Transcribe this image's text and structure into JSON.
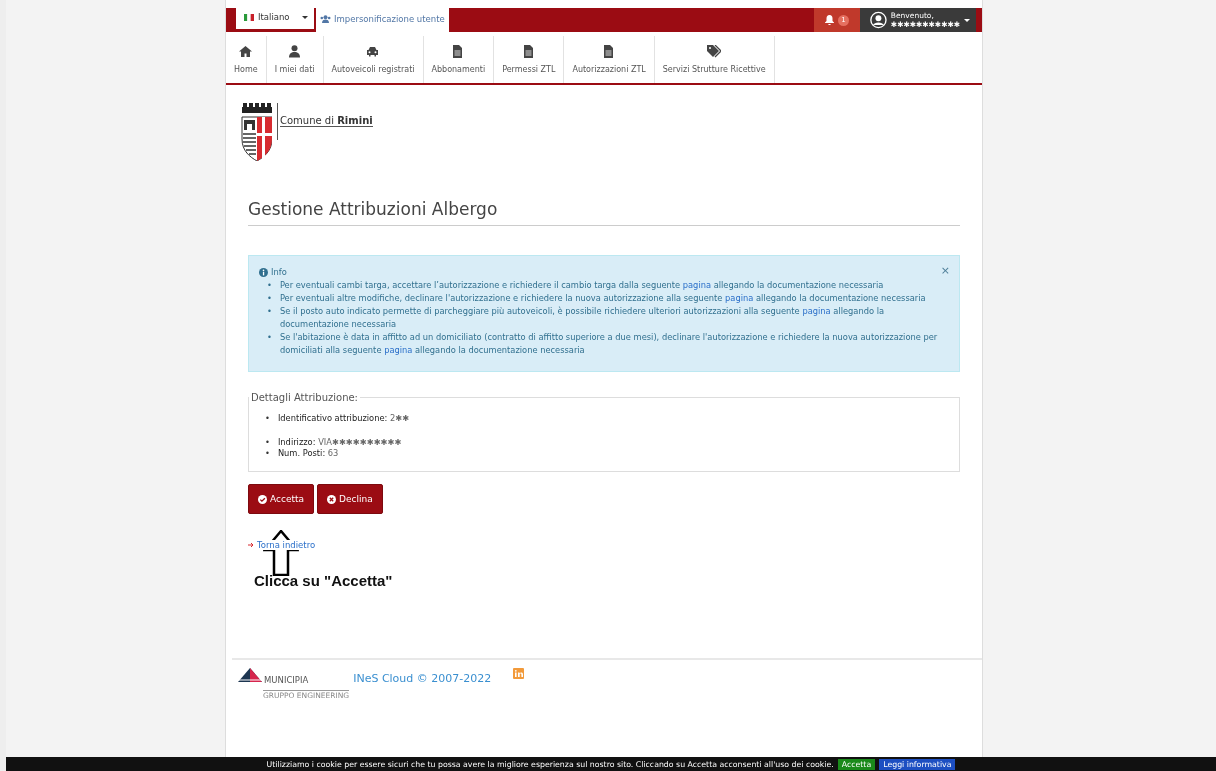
{
  "top_bar": {
    "language": "Italiano",
    "impersonation": "Impersonificazione utente",
    "notifications": "1",
    "welcome": "Benvenuto,",
    "user": "✱✱✱✱✱✱✱✱✱✱✱"
  },
  "nav": [
    {
      "label": "Home"
    },
    {
      "label": "I miei dati"
    },
    {
      "label": "Autoveicoli registrati"
    },
    {
      "label": "Abbonamenti"
    },
    {
      "label": "Permessi ZTL"
    },
    {
      "label": "Autorizzazioni ZTL"
    },
    {
      "label": "Servizi Strutture Ricettive"
    }
  ],
  "logo": {
    "prefix": "Comune di",
    "name": "Rimini"
  },
  "title": "Gestione Attribuzioni Albergo",
  "alert": {
    "title": "Info",
    "close": "×",
    "items": [
      {
        "marker": "•",
        "before": "Per eventuali cambi targa, accettare l’autorizzazione e richiedere il cambio targa dalla seguente",
        "link": "pagina",
        "after": "allegando la documentazione necessaria"
      },
      {
        "marker": "•",
        "before": "Per eventuali altre modifiche, declinare l'autorizzazione e richiedere la nuova autorizzazione alla seguente",
        "link": "pagina",
        "after": "allegando la documentazione necessaria"
      },
      {
        "marker": "•",
        "before": "Se il posto auto indicato permette di parcheggiare più autoveicoli, è possibile richiedere ulteriori autorizzazioni alla seguente",
        "link": "pagina",
        "after": "allegando la documentazione necessaria"
      },
      {
        "marker": "•",
        "before": "Se l'abitazione è data in affitto ad un domiciliato (contratto di affitto superiore a due mesi), declinare l'autorizzazione e richiedere la nuova autorizzazione per domiciliati alla seguente",
        "link": "pagina",
        "after": "allegando la documentazione necessaria"
      }
    ]
  },
  "details": {
    "legend": "Dettagli Attribuzione:",
    "items": [
      {
        "marker": "•",
        "label": "Identificativo attribuzione:",
        "value": "2✱✱"
      },
      {
        "marker": "•",
        "label": "Indirizzo:",
        "value": "VIA✱✱✱✱✱✱✱✱✱✱"
      },
      {
        "marker": "•",
        "label": "Num. Posti:",
        "value": "63"
      }
    ]
  },
  "buttons": [
    {
      "label": "Accetta",
      "kind": "accept"
    },
    {
      "label": "Declina",
      "kind": "decline"
    }
  ],
  "back_link": "Torna indietro",
  "annotation": "Clicca su \"Accetta\"",
  "footer": {
    "brand": "MUNICIPIA",
    "brand_sub": "GRUPPO ENGINEERING",
    "copyright": "INeS Cloud © 2007-2022"
  },
  "cookie_bar": {
    "text": "Utilizziamo i cookie per essere sicuri che tu possa avere la migliore esperienza sul nostro sito. Cliccando su Accetta acconsenti all'uso dei cookie.",
    "accept": "Accetta",
    "info": "Leggi informativa"
  }
}
